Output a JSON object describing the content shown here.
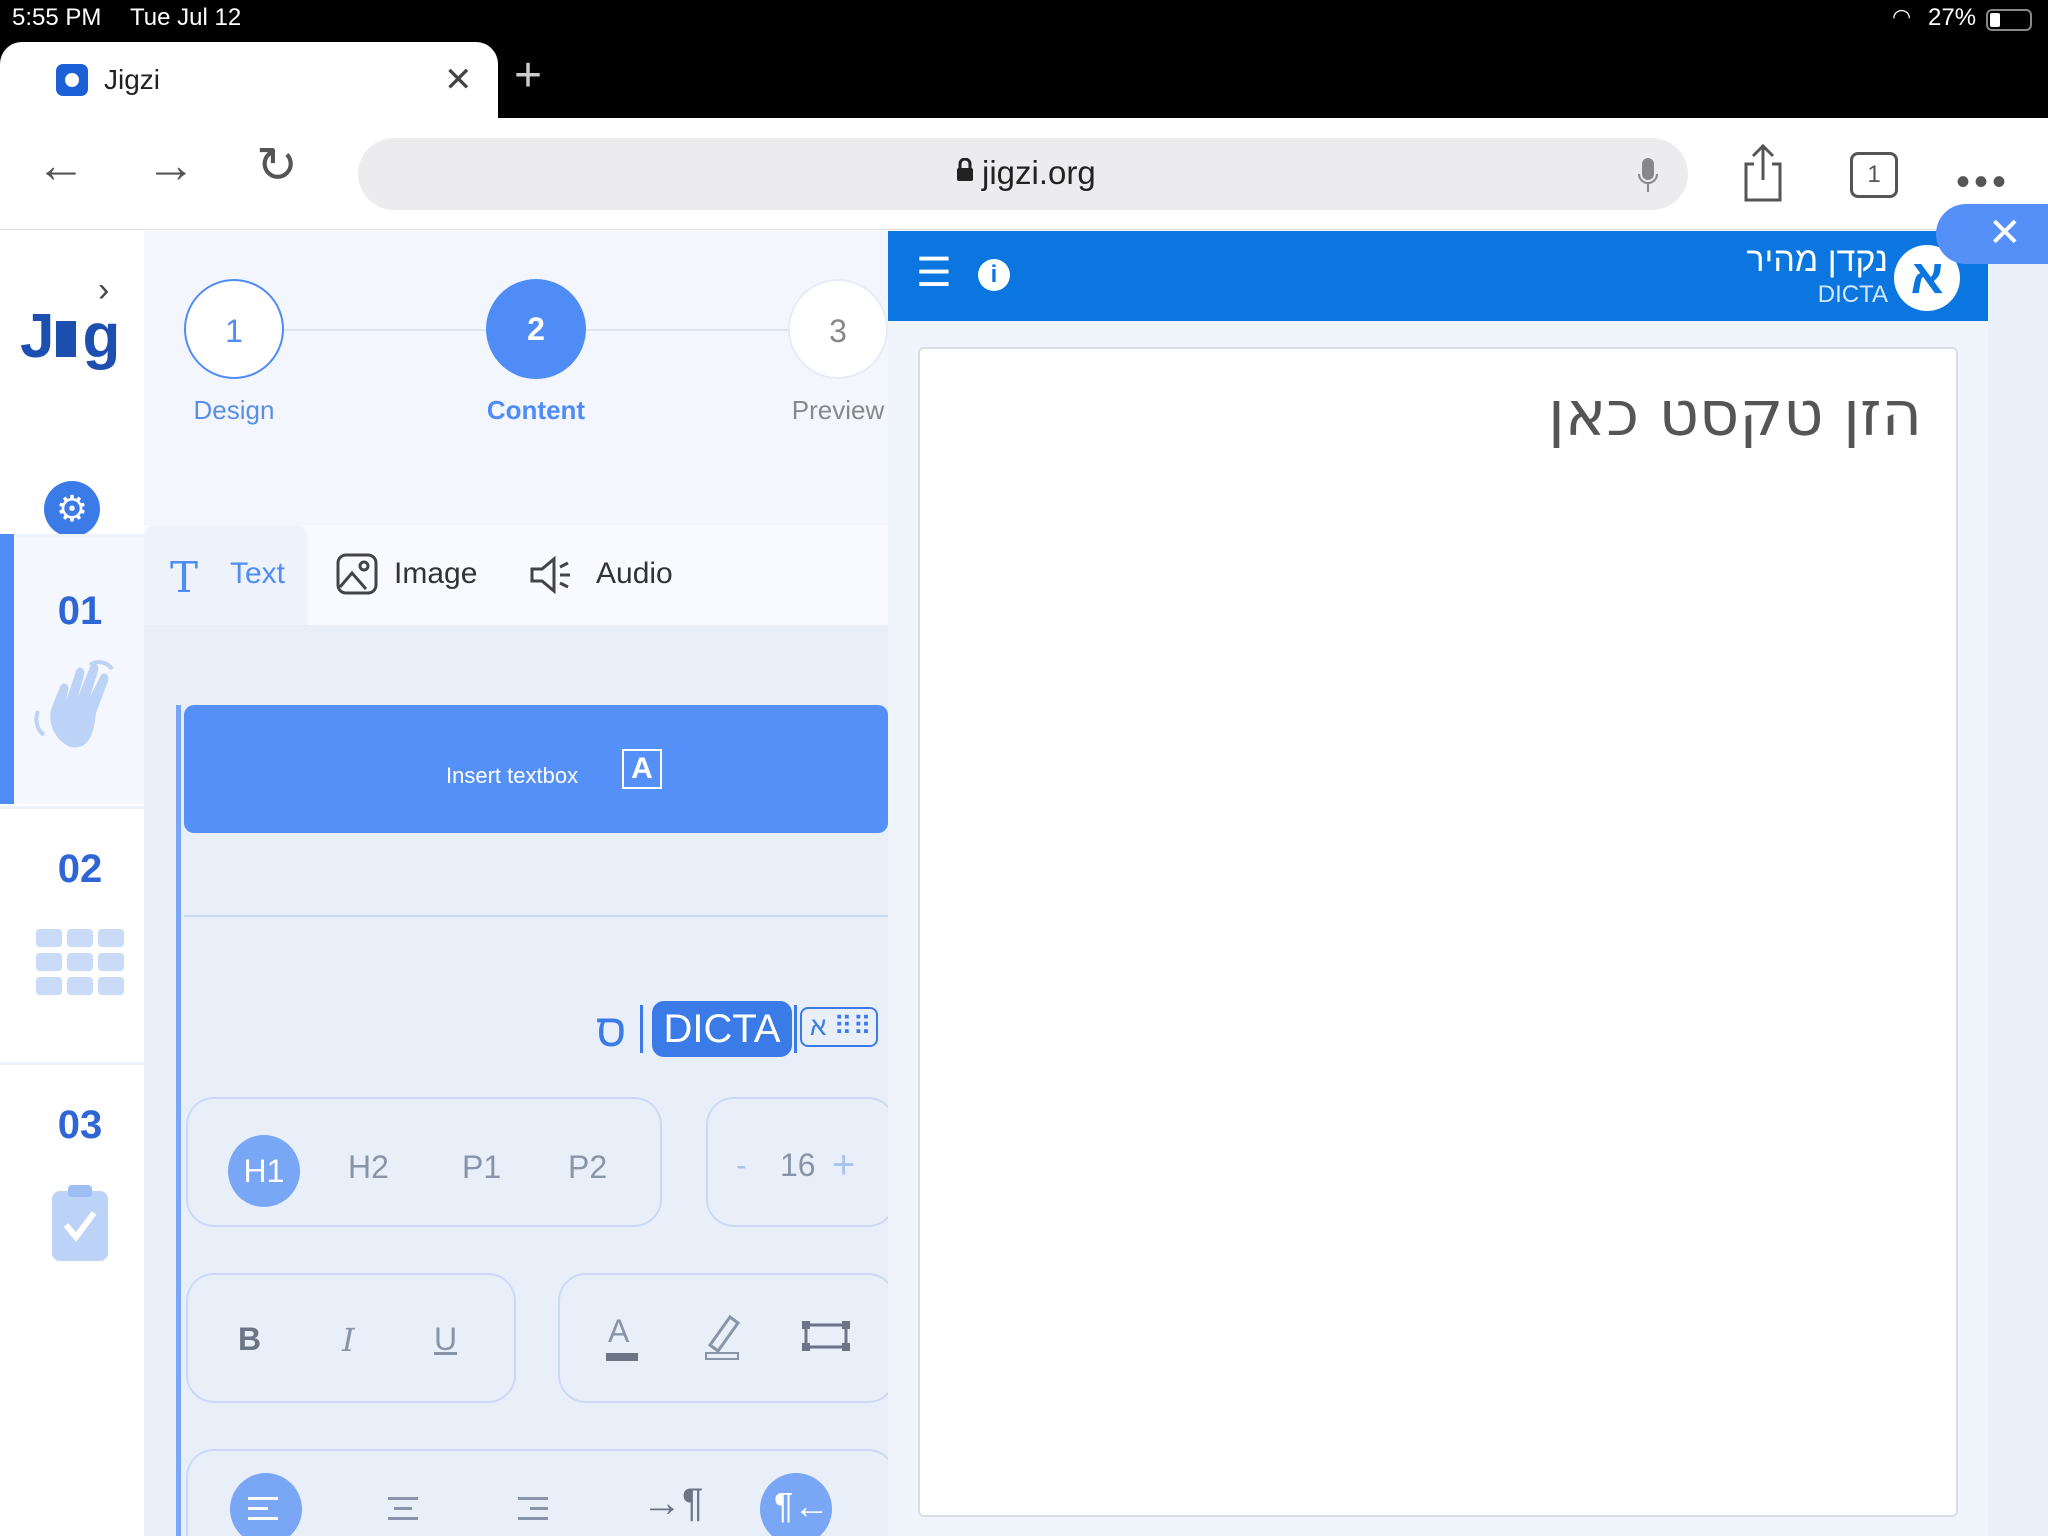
{
  "status_bar": {
    "time": "5:55 PM",
    "date": "Tue Jul 12",
    "battery": "27%"
  },
  "browser": {
    "tab_title": "Jigzi",
    "url": "jigzi.org",
    "tab_count": "1"
  },
  "sidebar": {
    "slides": [
      {
        "number": "01"
      },
      {
        "number": "02"
      },
      {
        "number": "03"
      }
    ]
  },
  "steps": [
    {
      "number": "1",
      "label": "Design"
    },
    {
      "number": "2",
      "label": "Content"
    },
    {
      "number": "3",
      "label": "Preview"
    }
  ],
  "content_tabs": {
    "text": "Text",
    "image": "Image",
    "audio": "Audio"
  },
  "insert_textbox": {
    "label": "Insert textbox",
    "icon_letter": "A"
  },
  "dicta_badge": "DICTA",
  "keyboard_icon_letter": "א",
  "heading_buttons": {
    "h1": "H1",
    "h2": "H2",
    "p1": "P1",
    "p2": "P2"
  },
  "font_size": {
    "minus": "-",
    "value": "16",
    "plus": "+"
  },
  "format_buttons": {
    "bold": "B",
    "italic": "I",
    "underline": "U",
    "color_letter": "A"
  },
  "dicta_widget": {
    "title": "נקדן מהיר",
    "subtitle": "DICTA",
    "logo_letter": "א",
    "placeholder": "הזן טקסט כאן",
    "info_glyph": "i"
  },
  "colors": {
    "brand_blue": "#0b76df",
    "accent_blue": "#5590f8",
    "logo_blue": "#1d4fb0"
  }
}
